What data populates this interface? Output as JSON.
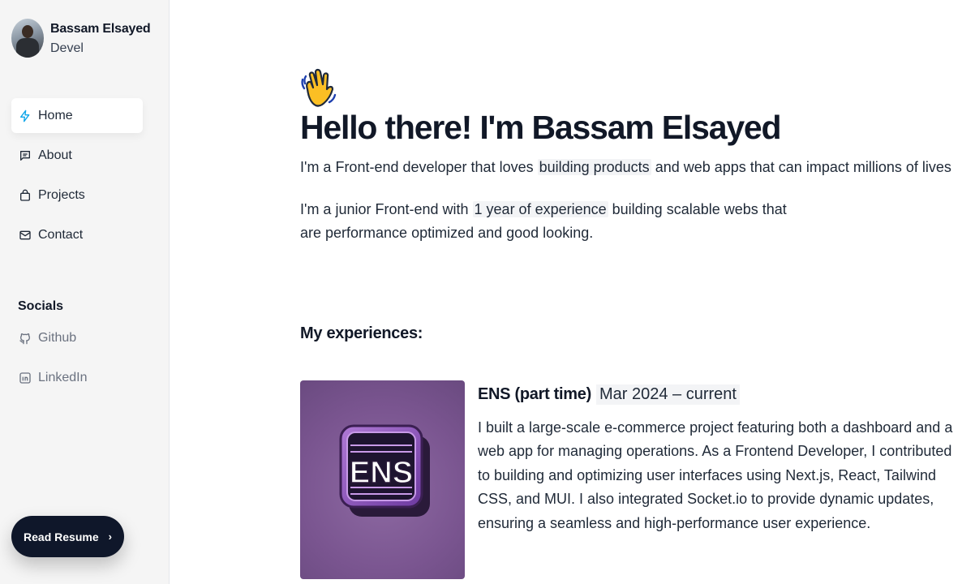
{
  "profile": {
    "name": "Bassam Elsayed",
    "role": "Devel"
  },
  "nav": {
    "items": [
      {
        "label": "Home",
        "icon": "bolt-icon",
        "active": true
      },
      {
        "label": "About",
        "icon": "message-square-icon"
      },
      {
        "label": "Projects",
        "icon": "shopping-bag-icon"
      },
      {
        "label": "Contact",
        "icon": "mail-icon"
      }
    ]
  },
  "socials": {
    "title": "Socials",
    "items": [
      {
        "label": "Github",
        "icon": "github-icon"
      },
      {
        "label": "LinkedIn",
        "icon": "linkedin-icon"
      }
    ]
  },
  "resume_button": {
    "label": "Read Resume",
    "chevron": "›"
  },
  "hero": {
    "emoji": "👋",
    "title": "Hello there! I'm Bassam Elsayed",
    "subtitle_pre": "I'm a Front-end developer that loves ",
    "subtitle_highlight": "building products",
    "subtitle_post": " and web apps that can impact millions of lives",
    "para_pre": "I'm a junior Front-end with ",
    "para_highlight": "1 year of experience",
    "para_post": " building scalable webs that are performance optimized and good looking."
  },
  "experiences": {
    "title": "My experiences:",
    "items": [
      {
        "logo_text": "ENS",
        "company": "ENS (part time)",
        "date": "Mar 2024 – current",
        "description": "I built a large-scale e-commerce project featuring both a dashboard and a web app for managing operations. As a Frontend Developer, I contributed to building and optimizing user interfaces using Next.js, React, Tailwind CSS, and MUI. I also integrated Socket.io to provide dynamic updates, ensuring a seamless and high-performance user experience."
      }
    ]
  },
  "colors": {
    "accent": "#0ea5e9",
    "dark": "#0f172a",
    "sidebar_bg": "#f5f5f5",
    "highlight_bg": "#f3f4f6"
  }
}
